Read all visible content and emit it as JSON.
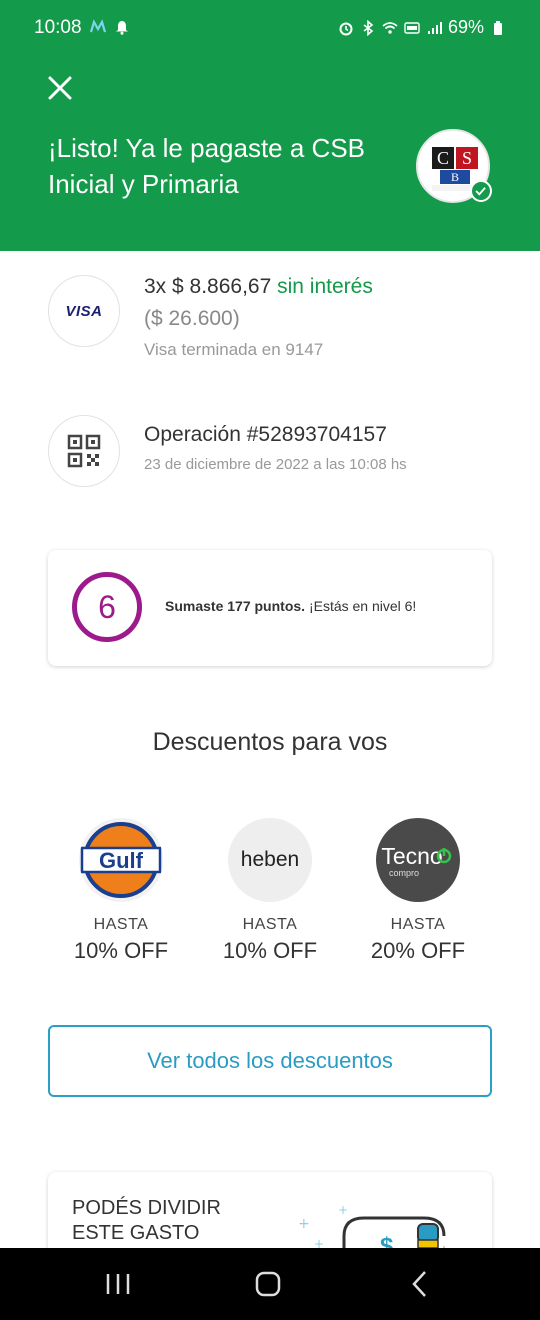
{
  "status_bar": {
    "time": "10:08",
    "battery": "69%"
  },
  "header": {
    "title": "¡Listo! Ya le pagaste a CSB Inicial y Primaria"
  },
  "payment": {
    "card_brand": "VISA",
    "installments": "3x $ 8.866,67",
    "interest": "sin interés",
    "total": "($ 26.600)",
    "card": "Visa terminada en 9147"
  },
  "operation": {
    "title": "Operación #52893704157",
    "date": "23 de diciembre de 2022 a las 10:08 hs"
  },
  "points": {
    "level": "6",
    "earned": "Sumaste 177 puntos.",
    "level_text": "¡Estás en nivel 6!"
  },
  "discounts": {
    "title": "Descuentos para vos",
    "items": [
      {
        "brand": "Gulf",
        "upto": "HASTA",
        "value": "10% OFF"
      },
      {
        "brand": "heben",
        "upto": "HASTA",
        "value": "10% OFF"
      },
      {
        "brand": "Tecno",
        "brand_sub": "compro",
        "upto": "HASTA",
        "value": "20% OFF"
      }
    ],
    "view_all": "Ver todos los descuentos"
  },
  "split_card": {
    "title": "PODÉS DIVIDIR ESTE GASTO"
  },
  "colors": {
    "primary_green": "#139a4a",
    "level_purple": "#9c1a8c",
    "link_blue": "#2a9cc4"
  }
}
